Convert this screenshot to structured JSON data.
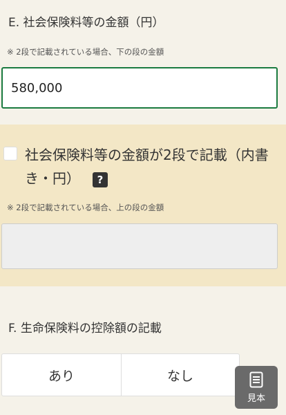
{
  "section_e": {
    "title": "E. 社会保険料等の金額（円）",
    "note": "※ 2段で記載されている場合、下の段の金額",
    "input_value": "580,000"
  },
  "two_tier": {
    "checkbox_label": "社会保険料等の金額が2段で記載（内書き・円）",
    "help_icon": "?",
    "note": "※ 2段で記載されている場合、上の段の金額"
  },
  "section_f": {
    "title": "F. 生命保険料の控除額の記載",
    "options": [
      "あり",
      "なし"
    ]
  },
  "sample_button": {
    "label": "見本",
    "icon": "document-icon"
  }
}
